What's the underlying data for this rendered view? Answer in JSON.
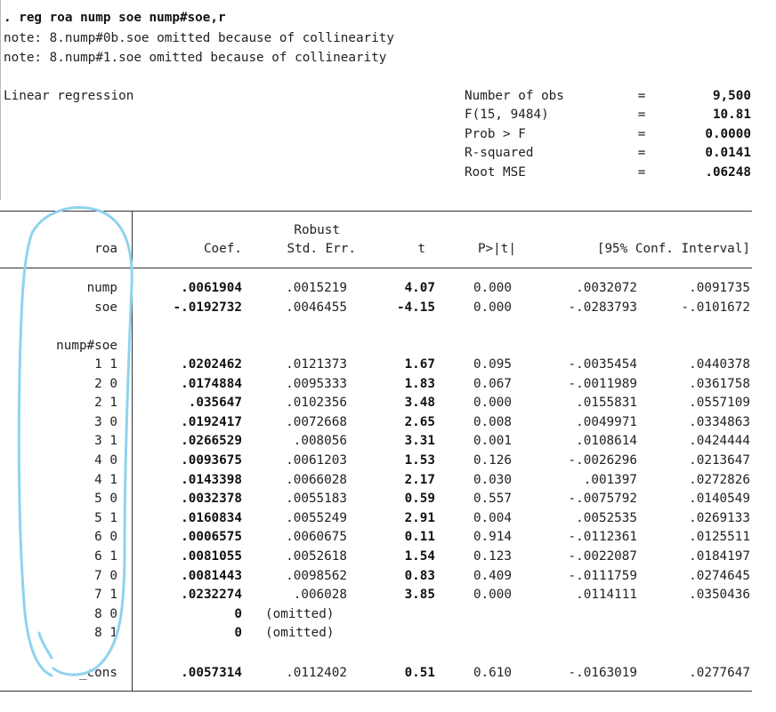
{
  "command": ". reg roa nump soe nump#soe,r",
  "notes": [
    "note: 8.nump#0b.soe omitted because of collinearity",
    "note: 8.nump#1.soe omitted because of collinearity"
  ],
  "model_title": "Linear regression",
  "stats": [
    {
      "label": "Number of obs",
      "eq": "=",
      "value": "9,500"
    },
    {
      "label": "F(15, 9484)",
      "eq": "=",
      "value": "10.81"
    },
    {
      "label": "Prob > F",
      "eq": "=",
      "value": "0.0000"
    },
    {
      "label": "R-squared",
      "eq": "=",
      "value": "0.0141"
    },
    {
      "label": "Root MSE",
      "eq": "=",
      "value": ".06248"
    }
  ],
  "table": {
    "header_top": "Robust",
    "headers": [
      "roa",
      "Coef.",
      "Std. Err.",
      "t",
      "P>|t|",
      "[95% Conf. Interval]"
    ],
    "rows": [
      {
        "label": "nump",
        "coef": ".0061904",
        "se": ".0015219",
        "t": "4.07",
        "p": "0.000",
        "lo": ".0032072",
        "hi": ".0091735"
      },
      {
        "label": "soe",
        "coef": "-.0192732",
        "se": ".0046455",
        "t": "-4.15",
        "p": "0.000",
        "lo": "-.0283793",
        "hi": "-.0101672"
      }
    ],
    "group_label": "nump#soe",
    "group_rows": [
      {
        "label": "1 1",
        "coef": ".0202462",
        "se": ".0121373",
        "t": "1.67",
        "p": "0.095",
        "lo": "-.0035454",
        "hi": ".0440378"
      },
      {
        "label": "2 0",
        "coef": ".0174884",
        "se": ".0095333",
        "t": "1.83",
        "p": "0.067",
        "lo": "-.0011989",
        "hi": ".0361758"
      },
      {
        "label": "2 1",
        "coef": ".035647",
        "se": ".0102356",
        "t": "3.48",
        "p": "0.000",
        "lo": ".0155831",
        "hi": ".0557109"
      },
      {
        "label": "3 0",
        "coef": ".0192417",
        "se": ".0072668",
        "t": "2.65",
        "p": "0.008",
        "lo": ".0049971",
        "hi": ".0334863"
      },
      {
        "label": "3 1",
        "coef": ".0266529",
        "se": ".008056",
        "t": "3.31",
        "p": "0.001",
        "lo": ".0108614",
        "hi": ".0424444"
      },
      {
        "label": "4 0",
        "coef": ".0093675",
        "se": ".0061203",
        "t": "1.53",
        "p": "0.126",
        "lo": "-.0026296",
        "hi": ".0213647"
      },
      {
        "label": "4 1",
        "coef": ".0143398",
        "se": ".0066028",
        "t": "2.17",
        "p": "0.030",
        "lo": ".001397",
        "hi": ".0272826"
      },
      {
        "label": "5 0",
        "coef": ".0032378",
        "se": ".0055183",
        "t": "0.59",
        "p": "0.557",
        "lo": "-.0075792",
        "hi": ".0140549"
      },
      {
        "label": "5 1",
        "coef": ".0160834",
        "se": ".0055249",
        "t": "2.91",
        "p": "0.004",
        "lo": ".0052535",
        "hi": ".0269133"
      },
      {
        "label": "6 0",
        "coef": ".0006575",
        "se": ".0060675",
        "t": "0.11",
        "p": "0.914",
        "lo": "-.0112361",
        "hi": ".0125511"
      },
      {
        "label": "6 1",
        "coef": ".0081055",
        "se": ".0052618",
        "t": "1.54",
        "p": "0.123",
        "lo": "-.0022087",
        "hi": ".0184197"
      },
      {
        "label": "7 0",
        "coef": ".0081443",
        "se": ".0098562",
        "t": "0.83",
        "p": "0.409",
        "lo": "-.0111759",
        "hi": ".0274645"
      },
      {
        "label": "7 1",
        "coef": ".0232274",
        "se": ".006028",
        "t": "3.85",
        "p": "0.000",
        "lo": ".0114111",
        "hi": ".0350436"
      },
      {
        "label": "8 0",
        "coef": "0",
        "se": "(omitted)",
        "t": "",
        "p": "",
        "lo": "",
        "hi": ""
      },
      {
        "label": "8 1",
        "coef": "0",
        "se": "(omitted)",
        "t": "",
        "p": "",
        "lo": "",
        "hi": ""
      }
    ],
    "cons_row": {
      "label": "_cons",
      "coef": ".0057314",
      "se": ".0112402",
      "t": "0.51",
      "p": "0.610",
      "lo": "-.0163019",
      "hi": ".0277647"
    }
  },
  "annotation_color": "#8fd3ee"
}
